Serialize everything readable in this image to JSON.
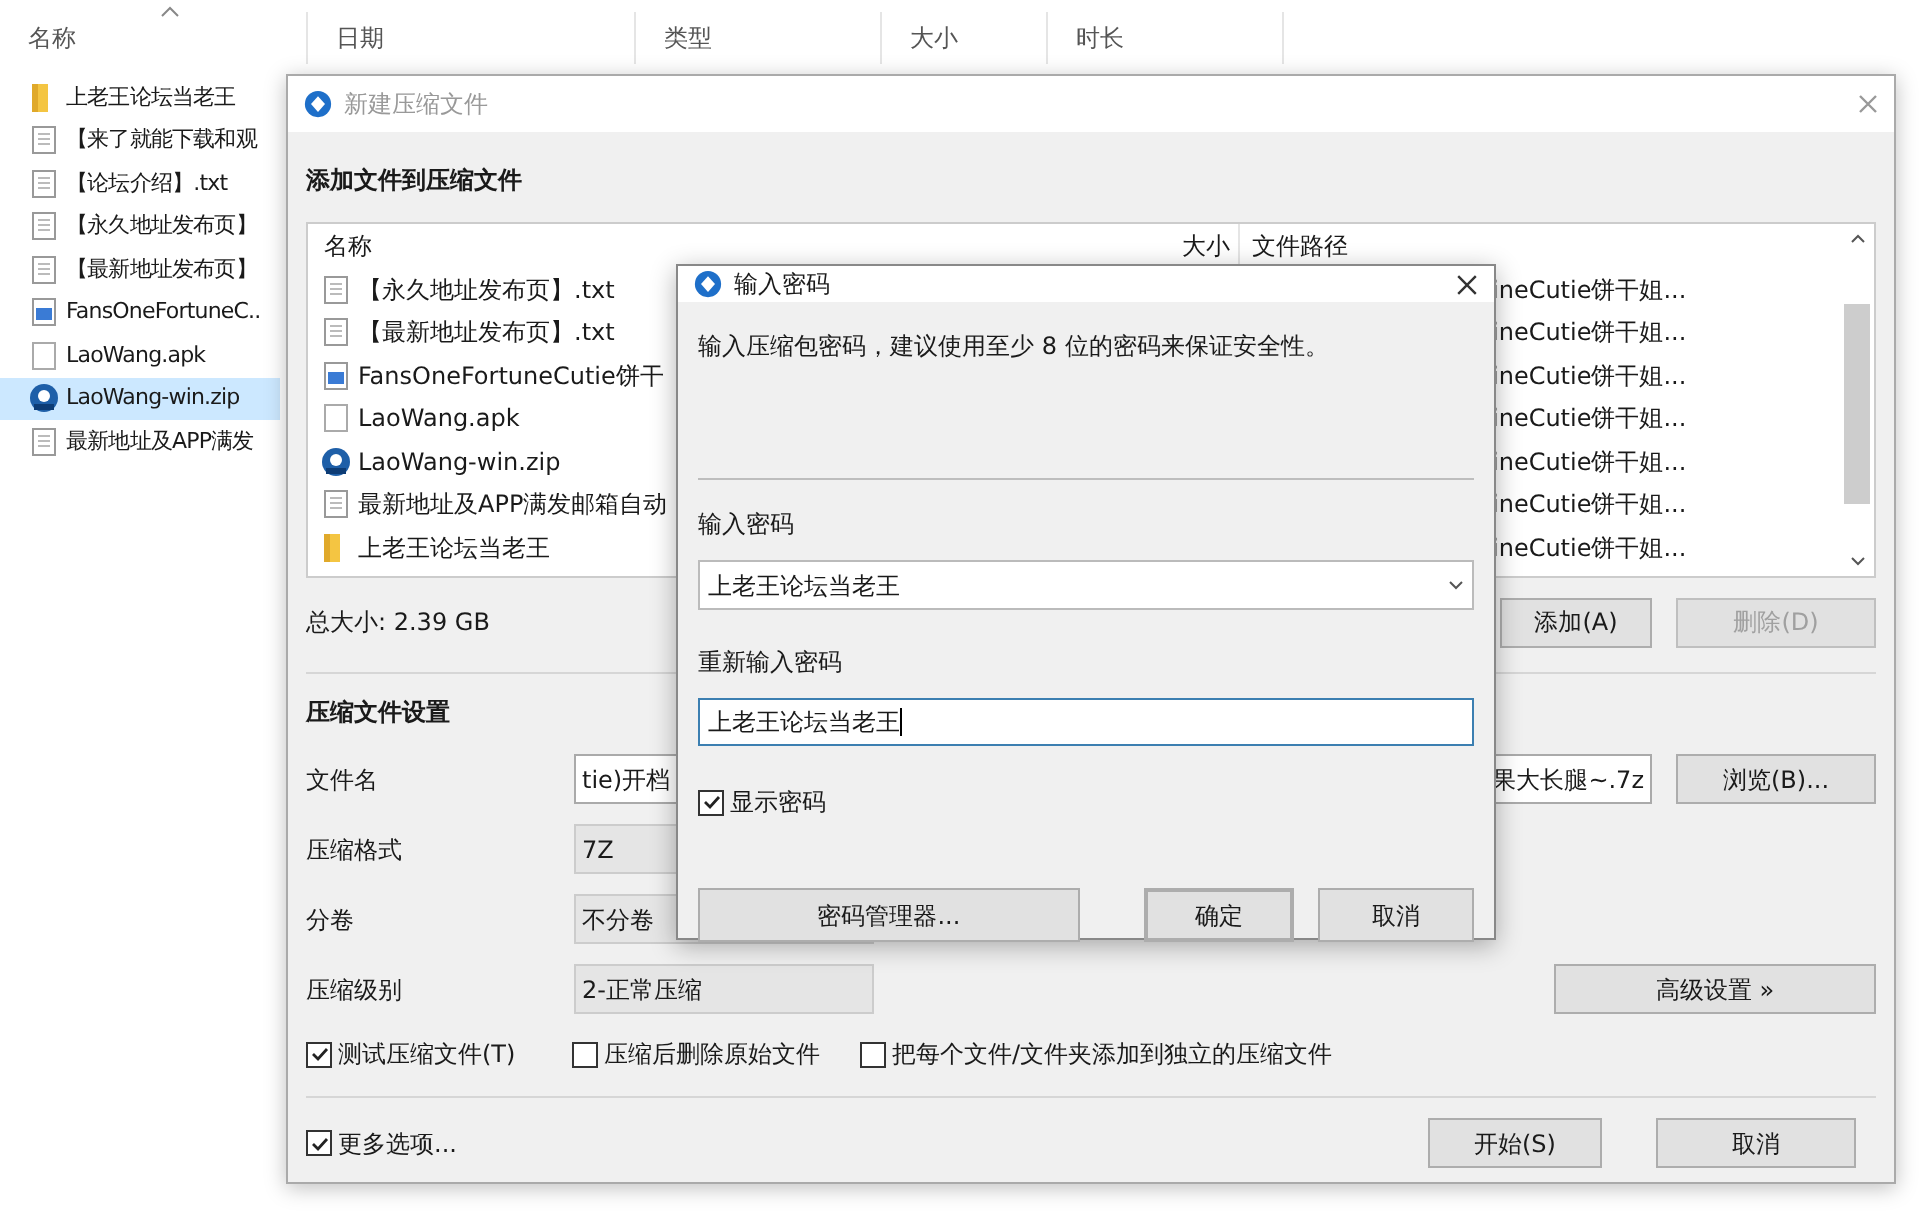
{
  "explorer": {
    "columns": [
      "名称",
      "日期",
      "类型",
      "大小",
      "时长"
    ],
    "items": [
      {
        "name": "上老王论坛当老王",
        "kind": "folder",
        "selected": false
      },
      {
        "name": "【来了就能下载和观",
        "kind": "text",
        "selected": false
      },
      {
        "name": "【论坛介绍】.txt",
        "kind": "text",
        "selected": false
      },
      {
        "name": "【永久地址发布页】",
        "kind": "text",
        "selected": false
      },
      {
        "name": "【最新地址发布页】",
        "kind": "text",
        "selected": false
      },
      {
        "name": "FansOneFortuneC..",
        "kind": "image",
        "selected": false
      },
      {
        "name": "LaoWang.apk",
        "kind": "blank",
        "selected": false
      },
      {
        "name": "LaoWang-win.zip",
        "kind": "zip",
        "selected": true
      },
      {
        "name": "最新地址及APP满发",
        "kind": "text",
        "selected": false
      }
    ]
  },
  "compress_dialog": {
    "title": "新建压缩文件",
    "section_title": "添加文件到压缩文件",
    "file_list": {
      "columns": [
        "名称",
        "大小",
        "文件路径"
      ],
      "rows": [
        {
          "name": "【永久地址发布页】.txt",
          "kind": "text",
          "path": "ineCutie饼干姐..."
        },
        {
          "name": "【最新地址发布页】.txt",
          "kind": "text",
          "path": "ineCutie饼干姐..."
        },
        {
          "name": "FansOneFortuneCutie饼干",
          "kind": "image",
          "path": "ineCutie饼干姐..."
        },
        {
          "name": "LaoWang.apk",
          "kind": "blank",
          "path": "ineCutie饼干姐..."
        },
        {
          "name": "LaoWang-win.zip",
          "kind": "zip",
          "path": "ineCutie饼干姐..."
        },
        {
          "name": "最新地址及APP满发邮箱自动",
          "kind": "text",
          "path": "ineCutie饼干姐..."
        },
        {
          "name": "上老王论坛当老王",
          "kind": "folder",
          "path": "ineCutie饼干姐..."
        }
      ]
    },
    "total_size": "总大小: 2.39 GB",
    "add_button": {
      "label": "添加(A)",
      "disabled": false
    },
    "delete_button": {
      "label": "删除(D)",
      "disabled": true
    },
    "settings_title": "压缩文件设置",
    "file_name": {
      "label": "文件名",
      "value_start": "tie)开档",
      "value_end": "果大长腿~.7z"
    },
    "browse_button": "浏览(B)...",
    "format": {
      "label": "压缩格式",
      "value": "7Z"
    },
    "volumes": {
      "label": "分卷",
      "value": "不分卷"
    },
    "level": {
      "label": "压缩级别",
      "value": "2-正常压缩"
    },
    "advanced_button": "高级设置 »",
    "options": [
      {
        "label": "测试压缩文件(T)",
        "checked": true
      },
      {
        "label": "压缩后删除原始文件",
        "checked": false
      },
      {
        "label": "把每个文件/文件夹添加到独立的压缩文件",
        "checked": false
      }
    ],
    "more_options": {
      "label": "更多选项...",
      "checked": true
    },
    "buttons": [
      "开始(S)",
      "取消"
    ]
  },
  "password_dialog": {
    "title": "输入密码",
    "hint": "输入压缩包密码，建议使用至少 8 位的密码来保证安全性。",
    "password_label": "输入密码",
    "password": "上老王论坛当老王",
    "confirm_label": "重新输入密码",
    "confirm_password": "上老王论坛当老王",
    "show_password": {
      "label": "显示密码",
      "checked": true
    },
    "buttons": [
      {
        "label": "密码管理器...",
        "default": false
      },
      {
        "label": "确定",
        "default": true
      },
      {
        "label": "取消",
        "default": false
      }
    ]
  }
}
